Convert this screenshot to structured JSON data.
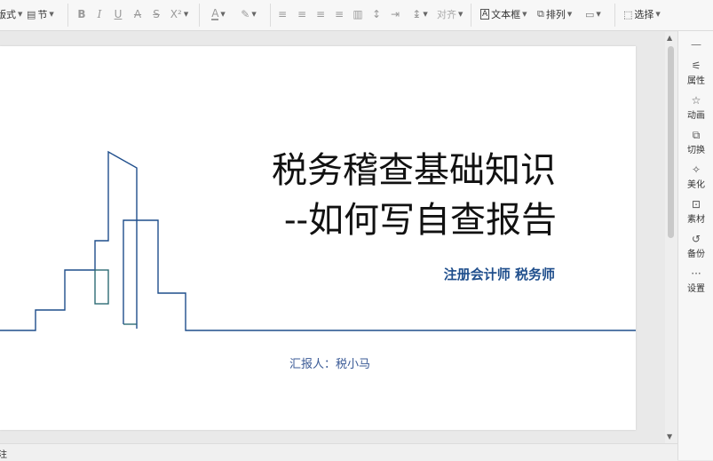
{
  "toolbar": {
    "format_label": "版式",
    "section_label": "节",
    "bold": "B",
    "italic": "I",
    "underline": "U",
    "strike": "A",
    "shadow": "S",
    "superscript": "X²",
    "font_color": "A",
    "align_label": "对齐",
    "textbox_label": "文本框",
    "arrange_label": "排列",
    "select_label": "选择"
  },
  "slide": {
    "title_line1": "税务稽查基础知识",
    "title_line2": "--如何写自查报告",
    "subtitle": "注册会计师  税务师",
    "reporter": "汇报人：税小马",
    "colors": {
      "line_blue": "#1f4e8c",
      "line_teal": "#2e6b74",
      "title": "#111111"
    }
  },
  "side_panel": {
    "items": [
      {
        "label": "属性",
        "icon": "sliders-icon"
      },
      {
        "label": "动画",
        "icon": "star-icon"
      },
      {
        "label": "切换",
        "icon": "transition-icon"
      },
      {
        "label": "美化",
        "icon": "magic-wand-icon"
      },
      {
        "label": "素材",
        "icon": "material-icon"
      },
      {
        "label": "备份",
        "icon": "history-icon"
      },
      {
        "label": "设置",
        "icon": "more-icon"
      }
    ]
  },
  "status": {
    "notes_label": "注"
  }
}
